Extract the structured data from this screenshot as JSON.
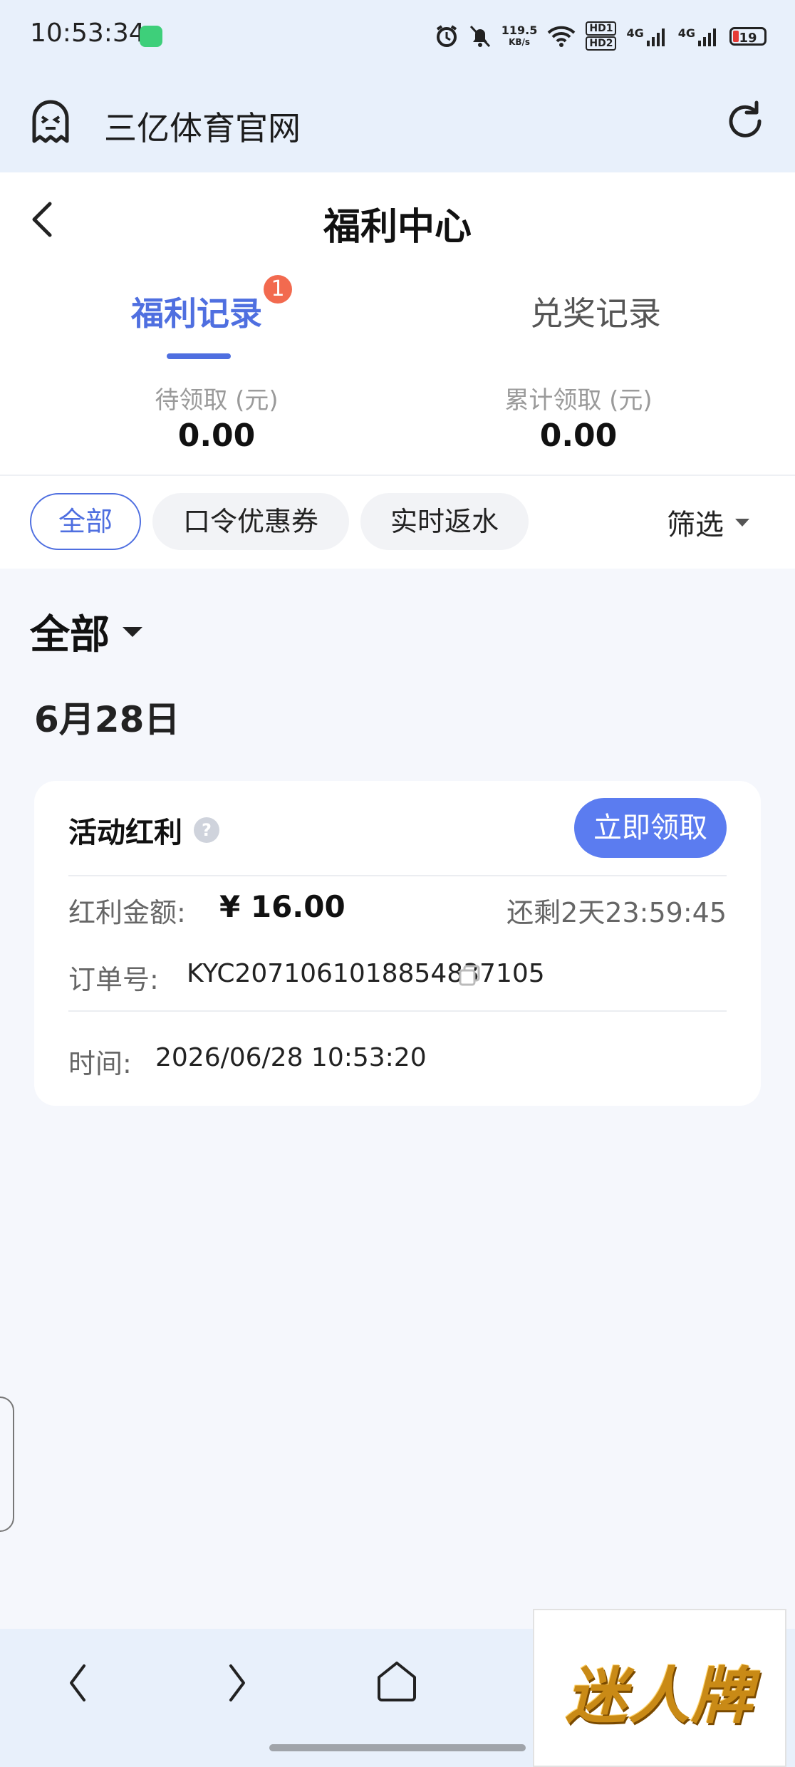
{
  "status_bar": {
    "time": "10:53:34",
    "net_speed_value": "119.5",
    "net_speed_unit": "KB/s",
    "hd1": "HD1",
    "hd2": "HD2",
    "sig1_label": "4G",
    "sig2_label": "4G",
    "battery": "19"
  },
  "browser": {
    "title": "三亿体育官网"
  },
  "page": {
    "title": "福利中心",
    "tabs": [
      {
        "label": "福利记录",
        "badge": "1",
        "active": true
      },
      {
        "label": "兑奖记录",
        "active": false
      }
    ],
    "summary": [
      {
        "label": "待领取 (元)",
        "value": "0.00"
      },
      {
        "label": "累计领取 (元)",
        "value": "0.00"
      }
    ],
    "filters": [
      {
        "label": "全部",
        "active": true
      },
      {
        "label": "口令优惠券",
        "active": false
      },
      {
        "label": "实时返水",
        "active": false
      }
    ],
    "filter_button": "筛选",
    "section_title": "全部",
    "date_title": "6月28日",
    "card": {
      "title": "活动红利",
      "help": "?",
      "claim_button": "立即领取",
      "amount_label": "红利金额:",
      "amount_value": "¥ 16.00",
      "remaining": "还剩2天23:59:45",
      "order_label": "订单号:",
      "order_value": "KYC2071061018854837105",
      "time_label": "时间:",
      "time_value": "2026/06/28 10:53:20"
    }
  },
  "watermark": {
    "text": "迷人牌"
  },
  "colors": {
    "accent": "#4f6fe0",
    "button": "#5b7cf0",
    "badge": "#f26a4f",
    "bar_bg": "#e8f0fb",
    "page_bg": "#f5f7fc"
  }
}
